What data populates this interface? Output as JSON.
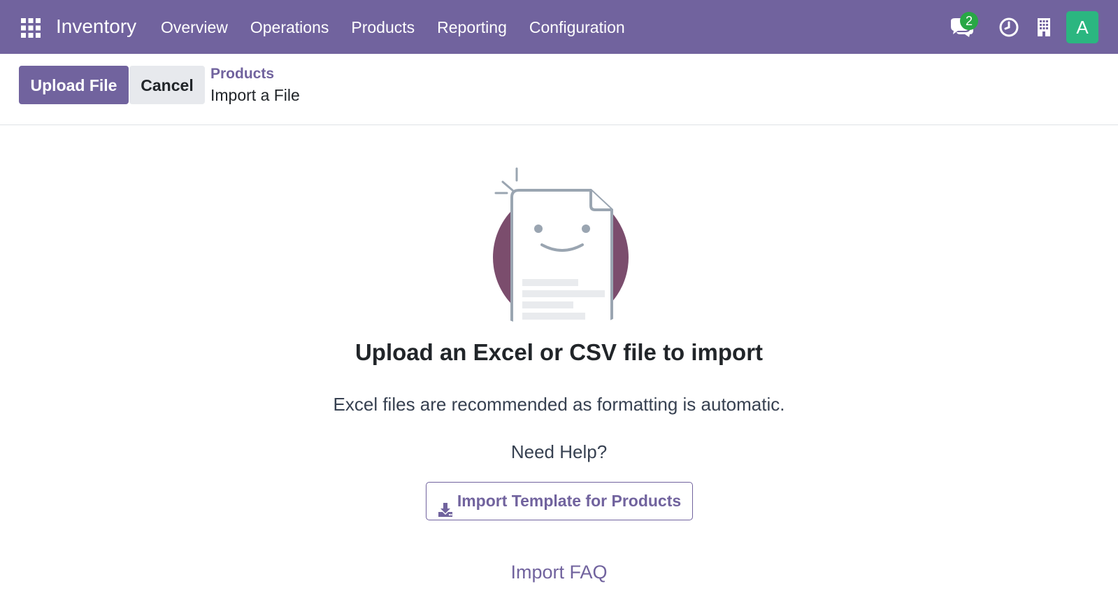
{
  "navbar": {
    "apps_icon": "apps-grid-icon",
    "brand": "Inventory",
    "menu": [
      {
        "label": "Overview"
      },
      {
        "label": "Operations"
      },
      {
        "label": "Products"
      },
      {
        "label": "Reporting"
      },
      {
        "label": "Configuration"
      }
    ],
    "systray": {
      "chat_icon": "chat-icon",
      "chat_badge": "2",
      "clock_icon": "clock-icon",
      "company_icon": "building-icon",
      "avatar_initial": "A"
    }
  },
  "control_panel": {
    "upload_label": "Upload File",
    "cancel_label": "Cancel",
    "breadcrumb_parent": "Products",
    "breadcrumb_current": "Import a File"
  },
  "main": {
    "illustration_icon": "smiling-document-icon",
    "heading": "Upload an Excel or CSV file to import",
    "subtext": "Excel files are recommended as formatting is automatic.",
    "need_help": "Need Help?",
    "template_button": "Import Template for Products",
    "template_icon": "download-icon",
    "faq_link": "Import FAQ"
  },
  "colors": {
    "brand": "#71639e",
    "avatar": "#2bb680",
    "badge": "#28a745"
  }
}
